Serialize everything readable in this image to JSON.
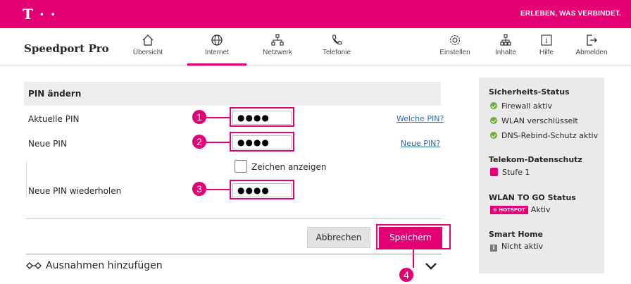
{
  "header": {
    "logo_text": "T · ·",
    "tagline": "ERLEBEN, WAS VERBINDET."
  },
  "nav": {
    "brand": "Speedport Pro",
    "items": [
      {
        "label": "Übersicht",
        "icon": "home-icon"
      },
      {
        "label": "Internet",
        "icon": "globe-icon"
      },
      {
        "label": "Netzwerk",
        "icon": "network-icon"
      },
      {
        "label": "Telefonie",
        "icon": "phone-icon"
      },
      {
        "label": "Einstellen",
        "icon": "gear-icon"
      },
      {
        "label": "Inhalte",
        "icon": "content-icon"
      },
      {
        "label": "Hilfe",
        "icon": "help-icon"
      },
      {
        "label": "Abmelden",
        "icon": "logout-icon"
      }
    ],
    "active": "Internet"
  },
  "pin_form": {
    "title": "PIN ändern",
    "current_label": "Aktuelle PIN",
    "current_value": "●●●●",
    "current_help": "Welche PIN?",
    "new_label": "Neue PIN",
    "new_value": "●●●●",
    "new_help": "Neue PIN?",
    "show_chars_label": "Zeichen anzeigen",
    "repeat_label": "Neue PIN wiederholen",
    "repeat_value": "●●●●",
    "cancel_label": "Abbrechen",
    "save_label": "Speichern",
    "exceptions_label": "Ausnahmen hinzufügen"
  },
  "badges": [
    "1",
    "2",
    "3",
    "4"
  ],
  "sidebar": {
    "security_title": "Sicherheits-Status",
    "security_items": [
      "Firewall aktiv",
      "WLAN verschlüsselt",
      "DNS-Rebind-Schutz aktiv"
    ],
    "privacy_title": "Telekom-Datenschutz",
    "privacy_level": "Stufe 1",
    "wlan_togo_title": "WLAN TO GO Status",
    "hotspot_badge": "⊙ HOTSPOT",
    "wlan_togo_status": "Aktiv",
    "smarthome_title": "Smart Home",
    "smarthome_status": "Nicht aktiv"
  },
  "colors": {
    "brand_magenta": "#e20074",
    "status_green": "#6fae3a",
    "link_blue": "#2b6aa8"
  }
}
